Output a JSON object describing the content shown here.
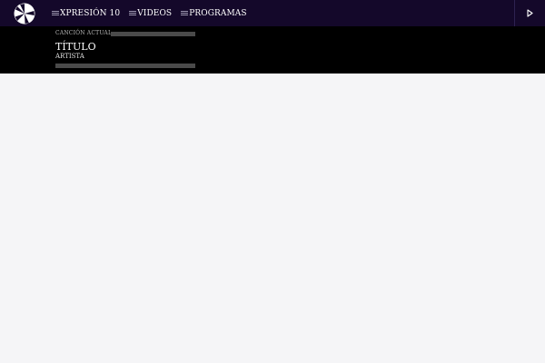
{
  "header": {
    "logo_icon": "station-logo-icon",
    "nav": [
      {
        "label": "XPRESIÓN 10",
        "icon": "menu-lines-icon"
      },
      {
        "label": "VIDEOS",
        "icon": "menu-lines-icon"
      },
      {
        "label": "PROGRAMAS",
        "icon": "menu-lines-icon"
      }
    ],
    "play_icon": "play-icon",
    "colors": {
      "bar_background": "#14082a",
      "text": "#ffffff"
    }
  },
  "now_playing": {
    "label": "CANCIÓN ACTUAL",
    "title": "TÍTULO",
    "artist": "ARTISTA",
    "colors": {
      "background": "#000000",
      "placeholder_bar": "#4a4a4a"
    }
  },
  "page": {
    "background": "#f5f5f7"
  }
}
